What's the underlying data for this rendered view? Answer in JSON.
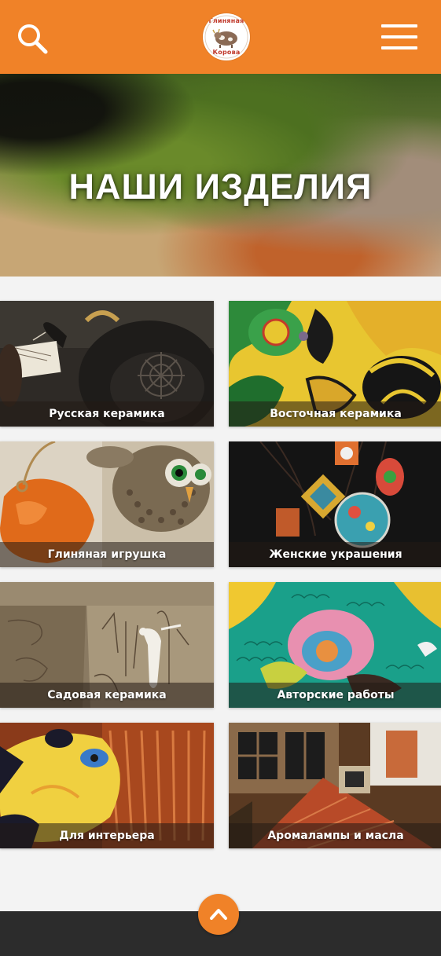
{
  "header": {
    "logo": {
      "top_text": "Глиняная",
      "bottom_text": "Корова",
      "icon": "cow-logo-icon"
    },
    "search_icon": "search-icon",
    "menu_icon": "hamburger-menu-icon",
    "accent_color": "#f08228"
  },
  "hero": {
    "title": "НАШИ ИЗДЕЛИЯ"
  },
  "categories": [
    {
      "label": "Русская керамика"
    },
    {
      "label": "Восточная керамика"
    },
    {
      "label": "Глиняная игрушка"
    },
    {
      "label": "Женские украшения"
    },
    {
      "label": "Садовая керамика"
    },
    {
      "label": "Авторские работы"
    },
    {
      "label": "Для интерьера"
    },
    {
      "label": "Аромалампы и масла"
    }
  ],
  "scroll_top_icon": "chevron-up-icon"
}
